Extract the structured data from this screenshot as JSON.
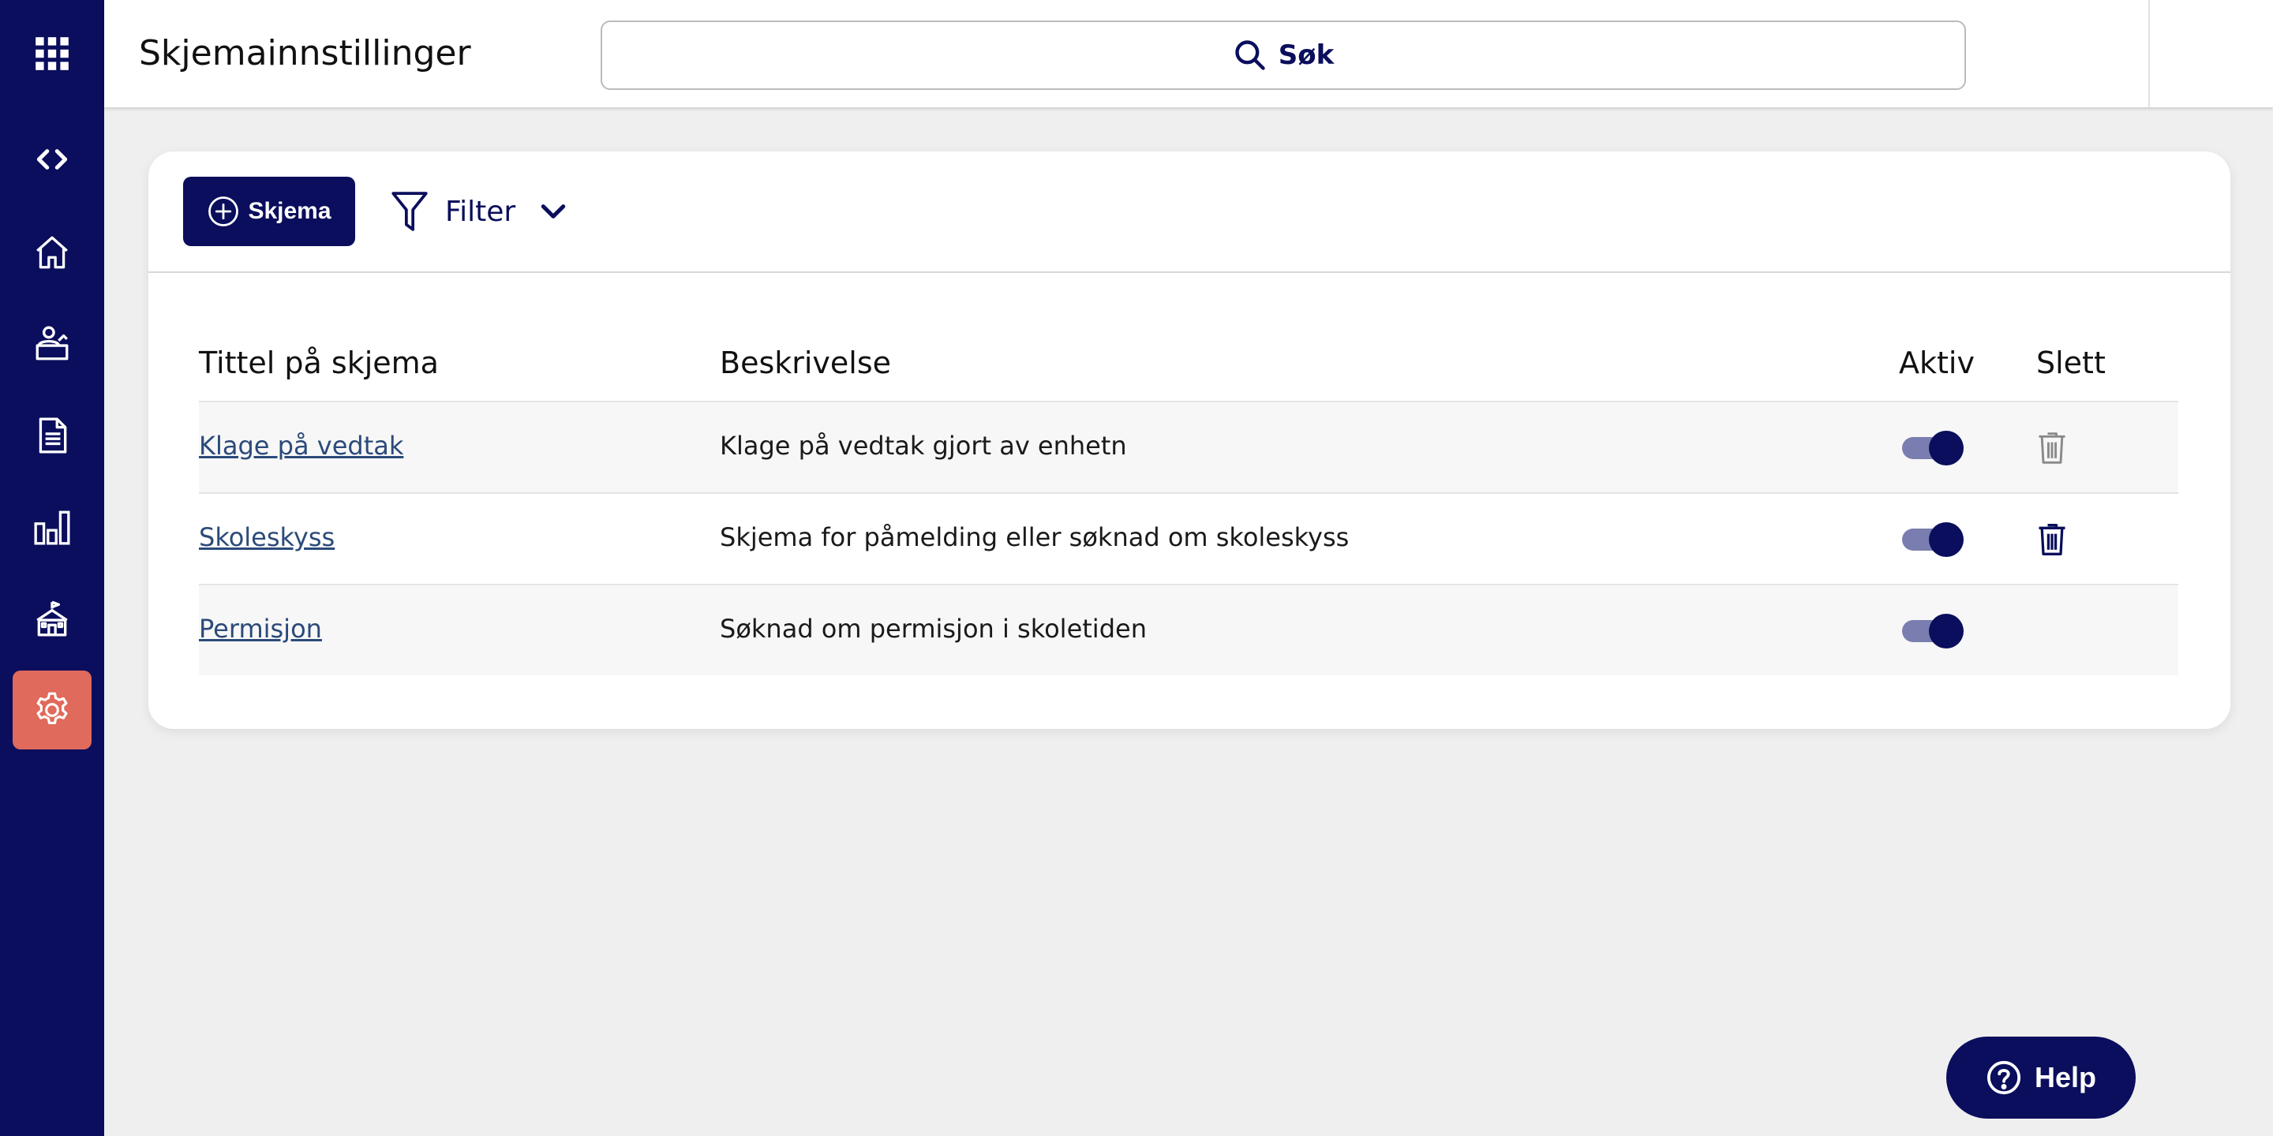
{
  "header": {
    "title": "Skjemainnstillinger",
    "search_label": "Søk"
  },
  "sidebar": {
    "items": [
      {
        "icon": "apps-grid-icon",
        "label": ""
      },
      {
        "icon": "collapse-arrows-icon",
        "label": ""
      },
      {
        "icon": "home-icon",
        "label": ""
      },
      {
        "icon": "user-desk-icon",
        "label": ""
      },
      {
        "icon": "document-icon",
        "label": ""
      },
      {
        "icon": "bar-chart-icon",
        "label": ""
      },
      {
        "icon": "school-icon",
        "label": ""
      },
      {
        "icon": "gear-icon",
        "label": "",
        "active": true
      }
    ]
  },
  "toolbar": {
    "new_label": "Skjema",
    "filter_label": "Filter"
  },
  "table": {
    "headers": {
      "title": "Tittel på skjema",
      "description": "Beskrivelse",
      "active": "Aktiv",
      "delete": "Slett"
    },
    "rows": [
      {
        "title": "Klage på vedtak",
        "description": "Klage på vedtak gjort av enhetn",
        "active": true,
        "deletable": true,
        "delete_icon_color": "#8a8a8a"
      },
      {
        "title": "Skoleskyss",
        "description": "Skjema for påmelding eller søknad om skoleskyss",
        "active": true,
        "deletable": true,
        "delete_icon_color": "#0a0e5c"
      },
      {
        "title": "Permisjon",
        "description": "Søknad om permisjon i skoletiden",
        "active": true,
        "deletable": false
      }
    ]
  },
  "help": {
    "label": "Help"
  },
  "colors": {
    "brand": "#0a0e5c",
    "active_nav": "#e06a5b",
    "link": "#2b4a7a",
    "toggle_track": "#7a7db0"
  }
}
